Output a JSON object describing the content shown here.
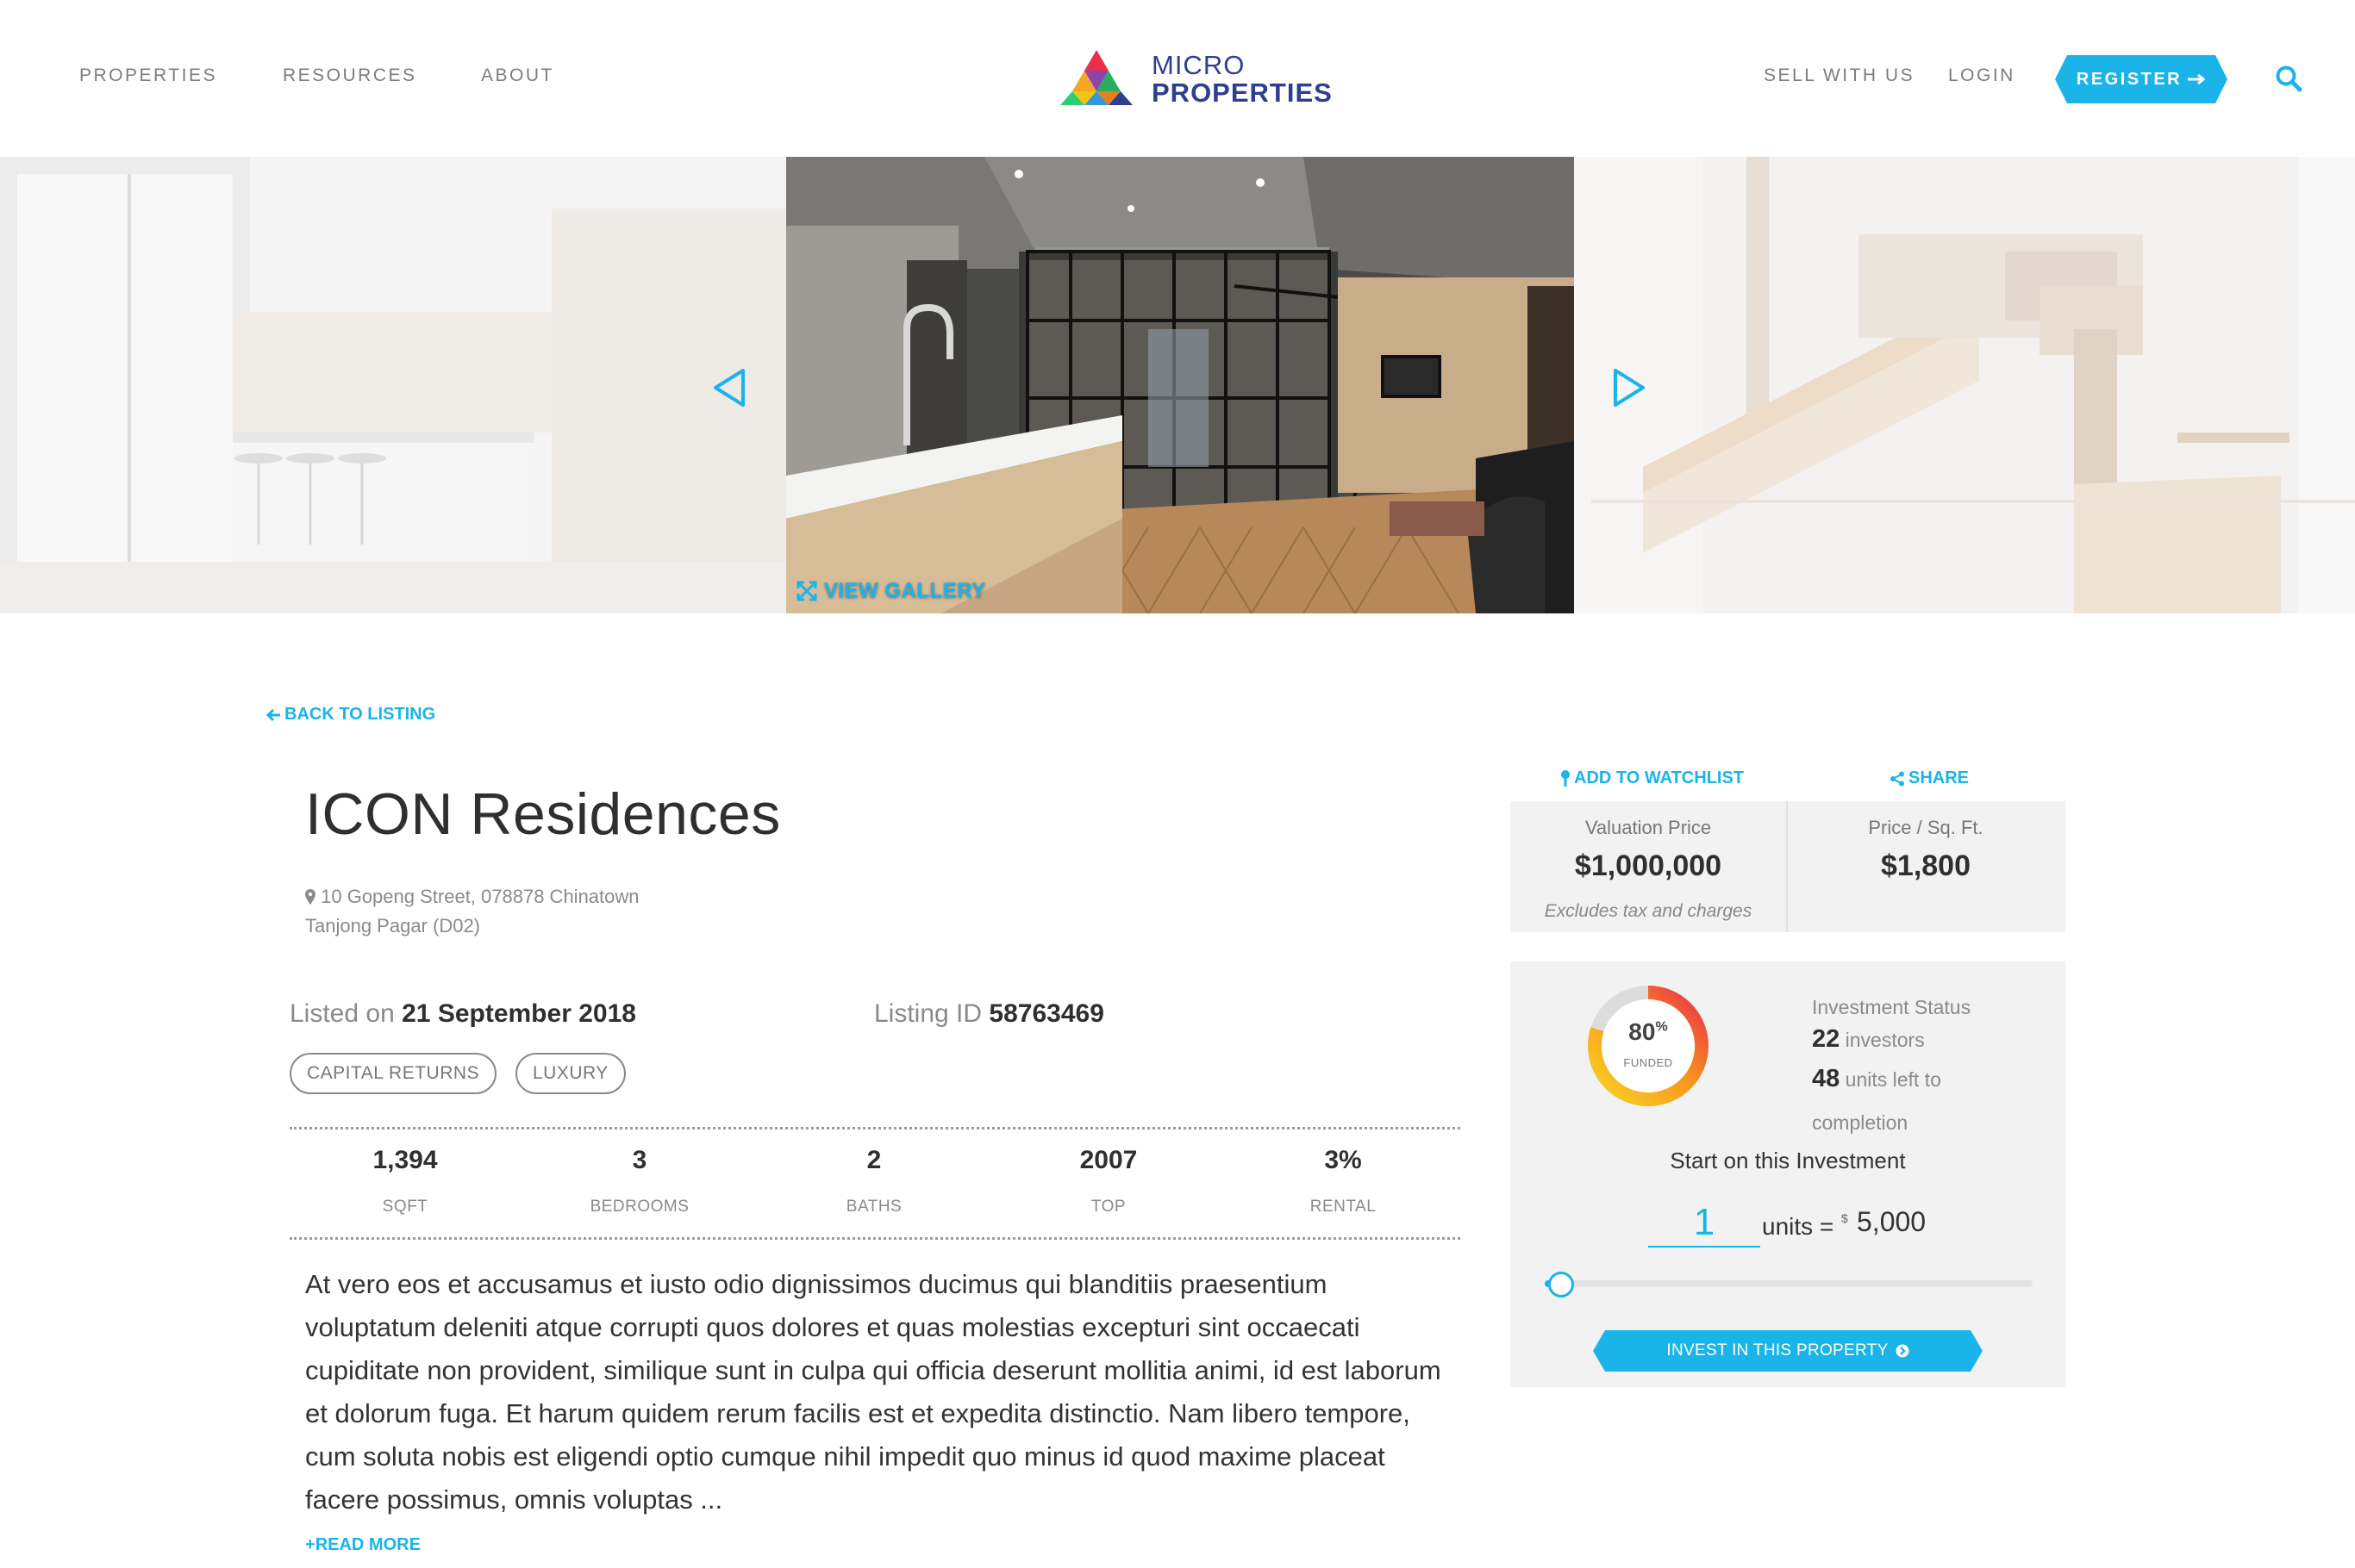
{
  "nav": {
    "left": [
      "PROPERTIES",
      "RESOURCES",
      "ABOUT"
    ],
    "sell": "SELL WITH US",
    "login": "LOGIN",
    "register": "REGISTER"
  },
  "logo": {
    "line1": "MICRO",
    "line2": "PROPERTIES"
  },
  "hero": {
    "view_gallery": "VIEW GALLERY"
  },
  "back_link": "BACK TO LISTING",
  "property": {
    "title": "ICON Residences",
    "address_line1": "10 Gopeng Street, 078878 Chinatown",
    "address_line2": "Tanjong Pagar (D02)",
    "listed_label": "Listed on",
    "listed_date": "21 September 2018",
    "listing_id_label": "Listing ID",
    "listing_id": "58763469",
    "tags": [
      "CAPITAL RETURNS",
      "LUXURY"
    ],
    "stats": [
      {
        "value": "1,394",
        "label": "SQFT"
      },
      {
        "value": "3",
        "label": "BEDROOMS"
      },
      {
        "value": "2",
        "label": "BATHS"
      },
      {
        "value": "2007",
        "label": "TOP"
      },
      {
        "value": "3%",
        "label": "RENTAL"
      }
    ],
    "description": "At vero eos et accusamus et iusto odio dignissimos ducimus qui blanditiis praesentium voluptatum deleniti atque corrupti quos dolores et quas molestias excepturi sint occaecati cupiditate non provident, similique sunt in culpa qui officia deserunt mollitia animi, id est laborum et dolorum fuga. Et harum quidem rerum facilis est et expedita distinctio. Nam libero tempore, cum soluta nobis est eligendi optio cumque nihil impedit quo minus id quod maxime placeat facere possimus, omnis voluptas ...",
    "read_more": "READ MORE"
  },
  "actions": {
    "watchlist": "ADD TO WATCHLIST",
    "share": "SHARE"
  },
  "pricing": {
    "valuation_label": "Valuation Price",
    "valuation_value": "$1,000,000",
    "valuation_note": "Excludes tax and charges",
    "psf_label": "Price / Sq. Ft.",
    "psf_value": "$1,800"
  },
  "investment": {
    "funded_percent": 80,
    "funded_number": "80",
    "percent_sign": "%",
    "funded_label": "FUNDED",
    "status_title": "Investment Status",
    "investors_count": "22",
    "investors_label": "investors",
    "units_left": "48",
    "units_left_label": "units left to",
    "units_left_label2": "completion",
    "start_title": "Start on this Investment",
    "units_value": "1",
    "units_label": "units =",
    "currency": "$",
    "total": "5,000",
    "slider_fraction": 0.02,
    "invest_button": "INVEST IN THIS PROPERTY"
  },
  "colors": {
    "accent": "#1bb4e8",
    "brand": "#2f3f8f"
  }
}
